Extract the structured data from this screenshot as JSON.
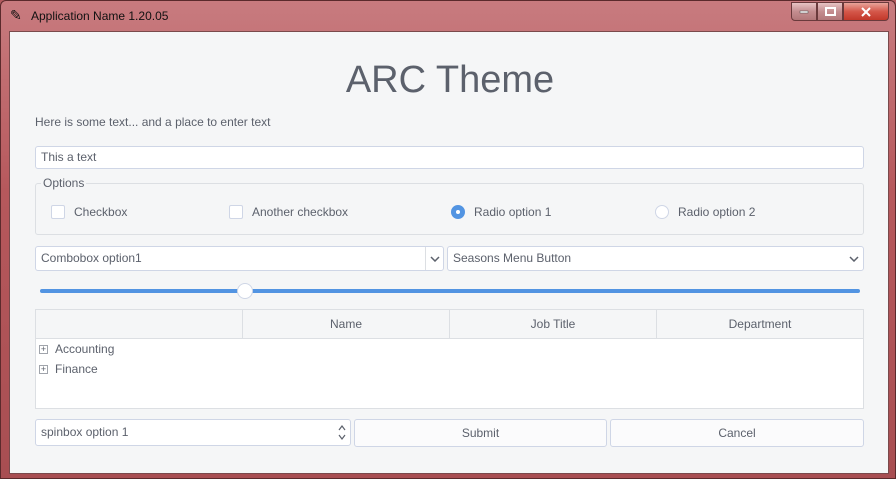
{
  "window": {
    "title": "Application Name 1.20.05",
    "icon": "feather-icon",
    "buttons": [
      "minimize",
      "maximize",
      "close"
    ]
  },
  "heading": "ARC Theme",
  "intro_text": "Here is some text... and a place to enter text",
  "entry": {
    "value": "This a text"
  },
  "options": {
    "title": "Options",
    "checkbox1": {
      "label": "Checkbox",
      "checked": false
    },
    "checkbox2": {
      "label": "Another checkbox",
      "checked": false
    },
    "radio1": {
      "label": "Radio option 1",
      "selected": true
    },
    "radio2": {
      "label": "Radio option 2",
      "selected": false
    }
  },
  "combobox": {
    "value": "Combobox option1"
  },
  "menu_button": {
    "label": "Seasons Menu Button"
  },
  "scale": {
    "value_fraction": 0.25
  },
  "tree": {
    "headers": [
      "",
      "Name",
      "Job Title",
      "Department"
    ],
    "rows": [
      {
        "label": "Accounting",
        "expander": "+"
      },
      {
        "label": "Finance",
        "expander": "+"
      }
    ]
  },
  "spinbox": {
    "value": "spinbox option 1"
  },
  "submit_label": "Submit",
  "cancel_label": "Cancel",
  "colors": {
    "accent": "#5294e2",
    "text": "#5c616c",
    "background": "#f5f6f7",
    "border": "#cfd6e6"
  }
}
